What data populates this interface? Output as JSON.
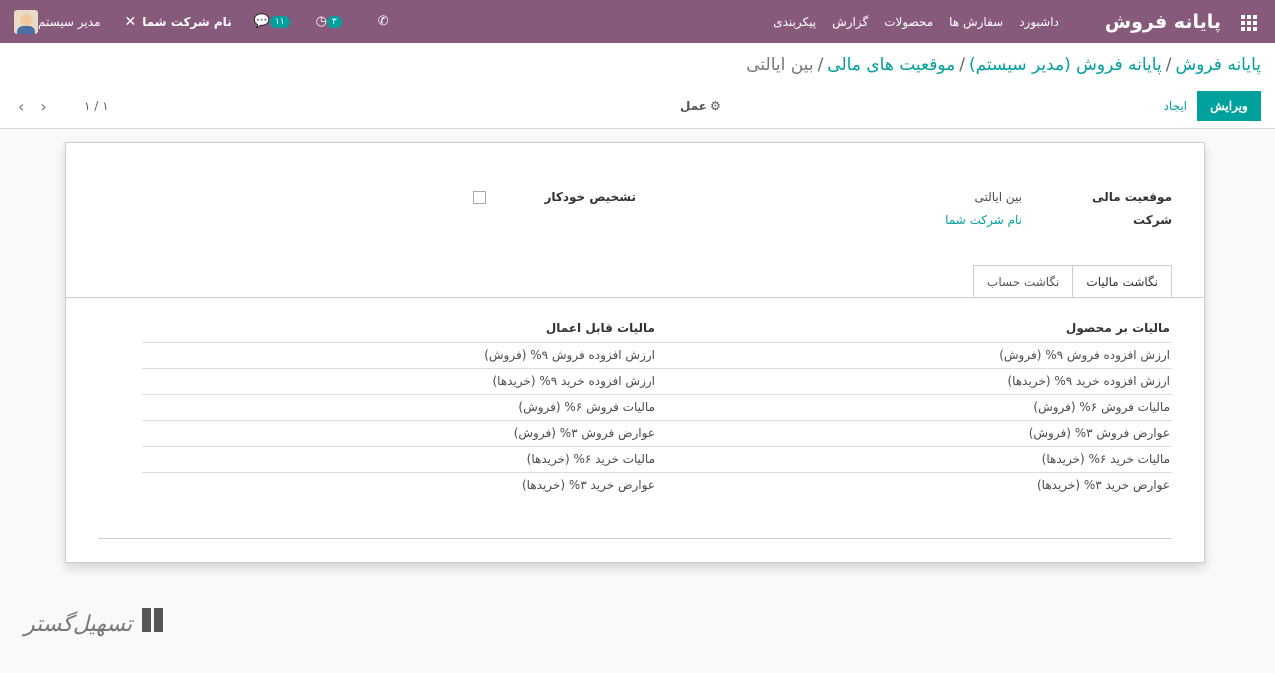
{
  "navbar": {
    "brand": "پایانه فروش",
    "menu": [
      "داشبورد",
      "سفارش ها",
      "محصولات",
      "گزارش",
      "پیکربندی"
    ],
    "user_name": "مدیر سیستم",
    "company_name": "نام شرکت شما",
    "messages_count": "۱۱",
    "activities_count": "۳",
    "colors": {
      "bar": "#875a7b",
      "accent": "#00a09d"
    }
  },
  "breadcrumb": {
    "items": [
      "پایانه فروش",
      "پایانه فروش (مدیر سیستم)",
      "موقعیت های مالی"
    ],
    "current": "بین ایالتی",
    "separator": "/"
  },
  "toolbar": {
    "edit_label": "ویرایش",
    "create_label": "ایجاد",
    "action_label": "عمل",
    "pager": "۱ / ۱"
  },
  "form": {
    "fiscal_position_label": "موقعیت مالی",
    "fiscal_position_value": "بین ایالتی",
    "company_label": "شرکت",
    "company_value": "نام شرکت شما",
    "auto_detect_label": "تشخیص خودکار"
  },
  "tabs": [
    "نگاشت مالیات",
    "نگاشت حساب"
  ],
  "tax_table": {
    "headers": [
      "مالیات بر محصول",
      "مالیات قابل اعمال"
    ],
    "rows": [
      [
        "ارزش افزوده فروش ۹% (فروش)",
        "ارزش افزوده فروش ۹% (فروش)"
      ],
      [
        "ارزش افزوده خرید ۹% (خریدها)",
        "ارزش افزوده خرید ۹% (خریدها)"
      ],
      [
        "مالیات فروش ۶% (فروش)",
        "مالیات فروش ۶% (فروش)"
      ],
      [
        "عوارض فروش ۳% (فروش)",
        "عوارض فروش ۳% (فروش)"
      ],
      [
        "مالیات خرید ۶% (خریدها)",
        "مالیات خرید ۶% (خریدها)"
      ],
      [
        "عوارض خرید ۳% (خریدها)",
        "عوارض خرید ۳% (خریدها)"
      ]
    ]
  },
  "watermark": "تسهیل‌گستر"
}
